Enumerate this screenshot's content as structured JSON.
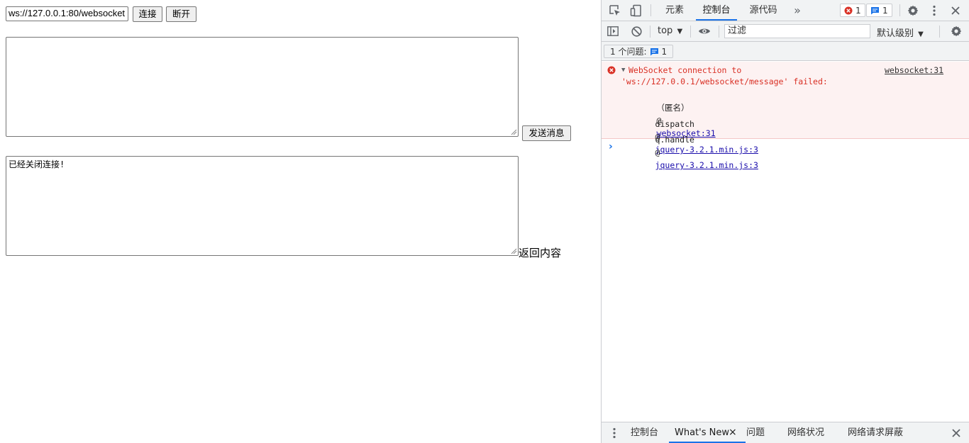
{
  "page": {
    "url_value": "ws://127.0.0.1:80/websocket",
    "connect_label": "连接",
    "disconnect_label": "断开",
    "send_message_value": "",
    "send_label": "发送消息",
    "response_value": "已经关闭连接!",
    "response_label": "返回内容"
  },
  "devtools": {
    "tabs": [
      {
        "label": "元素",
        "active": false
      },
      {
        "label": "控制台",
        "active": true
      },
      {
        "label": "源代码",
        "active": false
      }
    ],
    "more_tabs_glyph": "»",
    "error_count": "1",
    "message_count": "1",
    "toolbar": {
      "context": "top",
      "filter_placeholder": "过滤",
      "level": "默认级别"
    },
    "issues": {
      "label": "1 个问题:",
      "count": "1"
    },
    "console": {
      "error_text": "WebSocket connection to\n'ws://127.0.0.1/websocket/message' failed:",
      "error_source": "websocket:31",
      "stack": [
        {
          "fn": "（匿名）",
          "at": "@",
          "link": "websocket:31"
        },
        {
          "fn": "dispatch",
          "at": "@",
          "link": "jquery-3.2.1.min.js:3"
        },
        {
          "fn": "q.handle",
          "at": "@",
          "link": "jquery-3.2.1.min.js:3"
        }
      ],
      "prompt": "›"
    },
    "drawer": {
      "tabs": [
        {
          "label": "控制台",
          "active": false
        },
        {
          "label": "What's New",
          "active": true
        },
        {
          "label": "问题",
          "active": false
        },
        {
          "label": "网络状况",
          "active": false
        },
        {
          "label": "网络请求屏蔽",
          "active": false
        }
      ],
      "close_glyph": "×"
    },
    "colors": {
      "accent": "#1a73e8",
      "error": "#d93025",
      "error_bg": "#fdf2f2"
    }
  }
}
